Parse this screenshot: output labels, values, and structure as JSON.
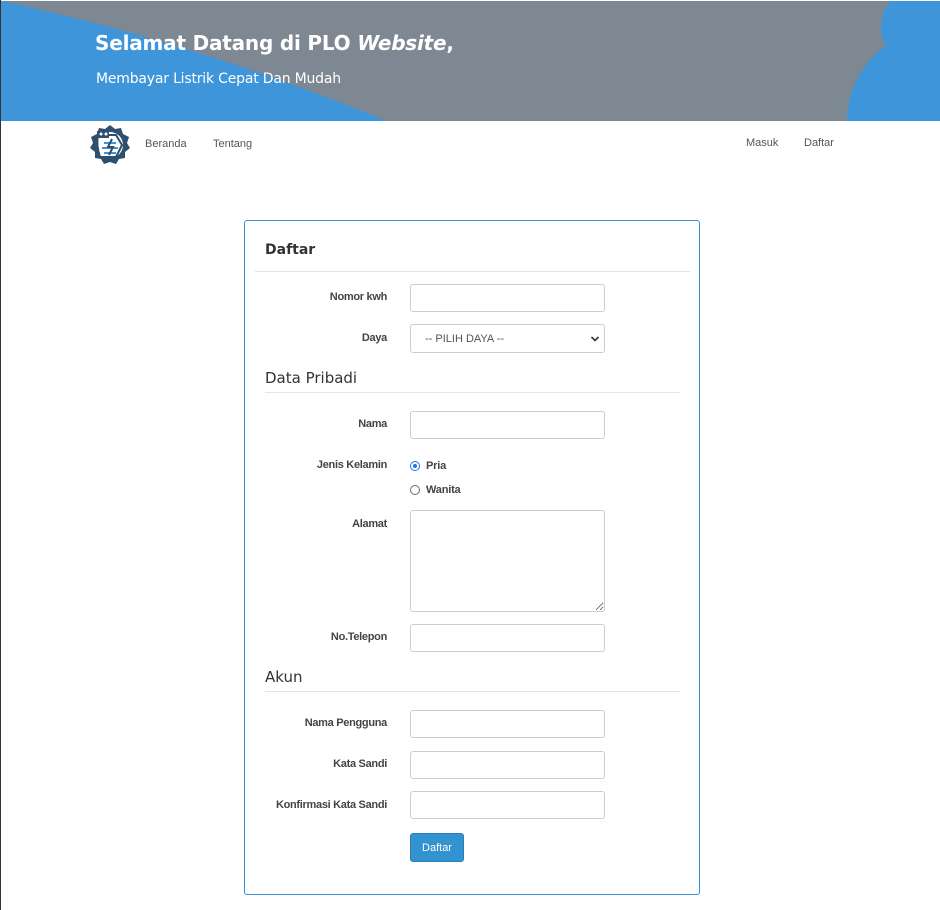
{
  "header": {
    "title_prefix": "Selamat Datang di PLO ",
    "title_emphasis": "Website",
    "title_suffix": ",",
    "subtitle": "Membayar Listrik Cepat Dan Mudah"
  },
  "nav": {
    "logo_icon": "pln-logo-icon",
    "left_links": [
      "Beranda",
      "Tentang"
    ],
    "right_links": [
      "Masuk",
      "Daftar"
    ]
  },
  "form": {
    "title": "Daftar",
    "fields": {
      "nomor_kwh": {
        "label": "Nomor kwh",
        "value": ""
      },
      "daya": {
        "label": "Daya",
        "selected": "-- PILIH DAYA --"
      }
    },
    "data_pribadi": {
      "heading": "Data Pribadi",
      "nama": {
        "label": "Nama",
        "value": ""
      },
      "jenis_kelamin": {
        "label": "Jenis Kelamin",
        "options": [
          "Pria",
          "Wanita"
        ],
        "selected": "Pria"
      },
      "alamat": {
        "label": "Alamat",
        "value": ""
      },
      "telepon": {
        "label": "No.Telepon",
        "value": ""
      }
    },
    "akun": {
      "heading": "Akun",
      "nama_pengguna": {
        "label": "Nama Pengguna",
        "value": ""
      },
      "kata_sandi": {
        "label": "Kata Sandi",
        "value": ""
      },
      "konfirmasi": {
        "label": "Konfirmasi Kata Sandi",
        "value": ""
      }
    },
    "submit_label": "Daftar"
  },
  "colors": {
    "banner_gray": "#7d8893",
    "banner_blue": "#3f95d9",
    "accent": "#3393d1",
    "card_border": "#3a8fd6"
  }
}
